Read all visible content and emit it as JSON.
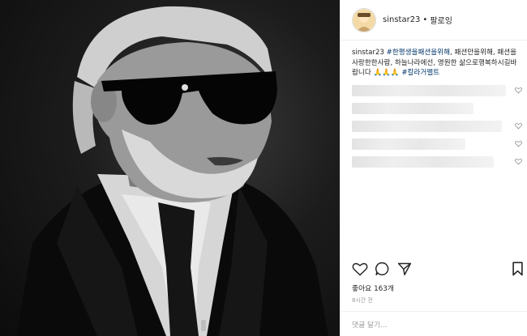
{
  "header": {
    "username": "sinstar23",
    "separator": "•",
    "follow_label": "팔로잉"
  },
  "caption": {
    "username": "sinstar23",
    "hashtag1": "#한평생을패션을위해",
    "body": ", 패션만을위해, 패션을사랑한한사람, 하늘나라에선, 영원한 삶으로행복하시길바랍니다",
    "emoji": " 🙏🙏🙏 ",
    "hashtag2": "#칼라거펠트"
  },
  "actions": {
    "like_icon": "heart-icon",
    "comment_icon": "comment-icon",
    "share_icon": "share-icon",
    "save_icon": "bookmark-icon"
  },
  "likes_text": "좋아요 163개",
  "time_text": "8시간 전",
  "comment_placeholder": "댓글 달기...",
  "colors": {
    "text": "#262626",
    "hashtag": "#003569",
    "muted": "#999999",
    "border": "#efefef"
  }
}
